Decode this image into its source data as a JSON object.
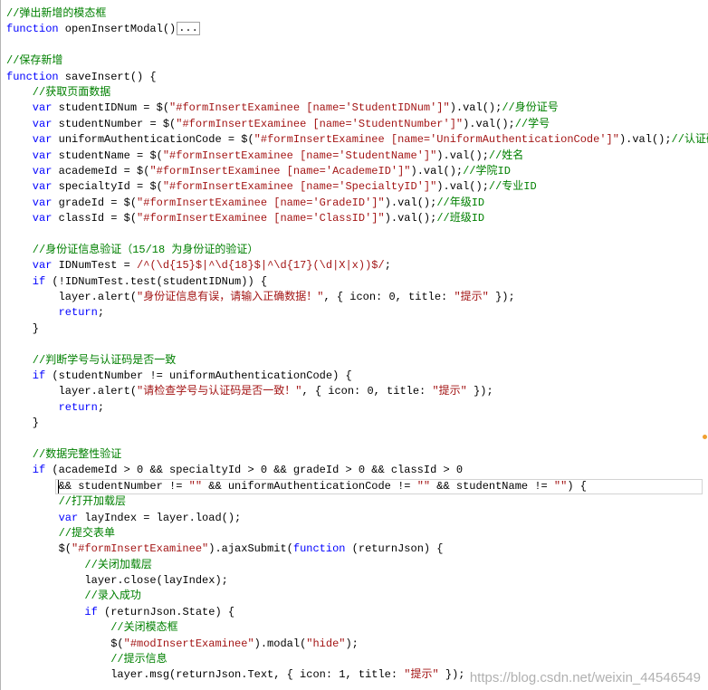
{
  "editor": {
    "colors": {
      "kw": "#0000FF",
      "cm": "#008000",
      "str": "#A31515",
      "re": "#A31515",
      "tx": "#000000",
      "fold": "#000000"
    },
    "lines": [
      {
        "tokens": [
          {
            "cm": "//弹出新增的模态框"
          }
        ]
      },
      {
        "tokens": [
          {
            "kw": "function"
          },
          {
            "tx": " openInsertModal()"
          },
          {
            "fold": "..."
          }
        ]
      },
      {
        "tokens": []
      },
      {
        "tokens": [
          {
            "cm": "//保存新增"
          }
        ]
      },
      {
        "tokens": [
          {
            "kw": "function"
          },
          {
            "tx": " saveInsert() {"
          }
        ]
      },
      {
        "tokens": [
          {
            "cm": "    //获取页面数据"
          }
        ]
      },
      {
        "tokens": [
          {
            "kw": "    var"
          },
          {
            "tx": " studentIDNum = $("
          },
          {
            "str": "\"#formInsertExaminee [name='StudentIDNum']\""
          },
          {
            "tx": ").val();"
          },
          {
            "cm": "//身份证号"
          }
        ]
      },
      {
        "tokens": [
          {
            "kw": "    var"
          },
          {
            "tx": " studentNumber = $("
          },
          {
            "str": "\"#formInsertExaminee [name='StudentNumber']\""
          },
          {
            "tx": ").val();"
          },
          {
            "cm": "//学号"
          }
        ]
      },
      {
        "tokens": [
          {
            "kw": "    var"
          },
          {
            "tx": " uniformAuthenticationCode = $("
          },
          {
            "str": "\"#formInsertExaminee [name='UniformAuthenticationCode']\""
          },
          {
            "tx": ").val();"
          },
          {
            "cm": "//认证码"
          }
        ]
      },
      {
        "tokens": [
          {
            "kw": "    var"
          },
          {
            "tx": " studentName = $("
          },
          {
            "str": "\"#formInsertExaminee [name='StudentName']\""
          },
          {
            "tx": ").val();"
          },
          {
            "cm": "//姓名"
          }
        ]
      },
      {
        "tokens": [
          {
            "kw": "    var"
          },
          {
            "tx": " academeId = $("
          },
          {
            "str": "\"#formInsertExaminee [name='AcademeID']\""
          },
          {
            "tx": ").val();"
          },
          {
            "cm": "//学院ID"
          }
        ]
      },
      {
        "tokens": [
          {
            "kw": "    var"
          },
          {
            "tx": " specialtyId = $("
          },
          {
            "str": "\"#formInsertExaminee [name='SpecialtyID']\""
          },
          {
            "tx": ").val();"
          },
          {
            "cm": "//专业ID"
          }
        ]
      },
      {
        "tokens": [
          {
            "kw": "    var"
          },
          {
            "tx": " gradeId = $("
          },
          {
            "str": "\"#formInsertExaminee [name='GradeID']\""
          },
          {
            "tx": ").val();"
          },
          {
            "cm": "//年级ID"
          }
        ]
      },
      {
        "tokens": [
          {
            "kw": "    var"
          },
          {
            "tx": " classId = $("
          },
          {
            "str": "\"#formInsertExaminee [name='ClassID']\""
          },
          {
            "tx": ").val();"
          },
          {
            "cm": "//班级ID"
          }
        ]
      },
      {
        "tokens": []
      },
      {
        "tokens": [
          {
            "cm": "    //身份证信息验证（15/18 为身份证的验证）"
          }
        ]
      },
      {
        "tokens": [
          {
            "kw": "    var"
          },
          {
            "tx": " IDNumTest = "
          },
          {
            "re": "/^(\\d{15}$|^\\d{18}$|^\\d{17}(\\d|X|x))$/"
          },
          {
            "tx": ";"
          }
        ]
      },
      {
        "tokens": [
          {
            "kw": "    if"
          },
          {
            "tx": " (!IDNumTest.test(studentIDNum)) {"
          }
        ]
      },
      {
        "tokens": [
          {
            "tx": "        layer.alert("
          },
          {
            "str": "\"身份证信息有误，请输入正确数据！\""
          },
          {
            "tx": ", { icon: 0, title: "
          },
          {
            "str": "\"提示\""
          },
          {
            "tx": " });"
          }
        ]
      },
      {
        "tokens": [
          {
            "kw": "        return"
          },
          {
            "tx": ";"
          }
        ]
      },
      {
        "tokens": [
          {
            "tx": "    }"
          }
        ]
      },
      {
        "tokens": []
      },
      {
        "tokens": [
          {
            "cm": "    //判断学号与认证码是否一致"
          }
        ]
      },
      {
        "tokens": [
          {
            "kw": "    if"
          },
          {
            "tx": " (studentNumber != uniformAuthenticationCode) {"
          }
        ]
      },
      {
        "tokens": [
          {
            "tx": "        layer.alert("
          },
          {
            "str": "\"请检查学号与认证码是否一致！\""
          },
          {
            "tx": ", { icon: 0, title: "
          },
          {
            "str": "\"提示\""
          },
          {
            "tx": " });"
          }
        ]
      },
      {
        "tokens": [
          {
            "kw": "        return"
          },
          {
            "tx": ";"
          }
        ]
      },
      {
        "tokens": [
          {
            "tx": "    }"
          }
        ]
      },
      {
        "tokens": []
      },
      {
        "tokens": [
          {
            "cm": "    //数据完整性验证"
          }
        ]
      },
      {
        "tokens": [
          {
            "kw": "    if"
          },
          {
            "tx": " (academeId > 0 && specialtyId > 0 && gradeId > 0 && classId > 0"
          }
        ]
      },
      {
        "current": true,
        "tokens": [
          {
            "tx": "        && studentNumber != "
          },
          {
            "str": "\"\""
          },
          {
            "tx": " && uniformAuthenticationCode != "
          },
          {
            "str": "\"\""
          },
          {
            "tx": " && studentName != "
          },
          {
            "str": "\"\""
          },
          {
            "tx": ") {"
          }
        ]
      },
      {
        "tokens": [
          {
            "cm": "        //打开加载层"
          }
        ]
      },
      {
        "tokens": [
          {
            "kw": "        var"
          },
          {
            "tx": " layIndex = layer.load();"
          }
        ]
      },
      {
        "tokens": [
          {
            "cm": "        //提交表单"
          }
        ]
      },
      {
        "tokens": [
          {
            "tx": "        $("
          },
          {
            "str": "\"#formInsertExaminee\""
          },
          {
            "tx": ").ajaxSubmit("
          },
          {
            "kw": "function"
          },
          {
            "tx": " (returnJson) {"
          }
        ]
      },
      {
        "tokens": [
          {
            "cm": "            //关闭加载层"
          }
        ]
      },
      {
        "tokens": [
          {
            "tx": "            layer.close(layIndex);"
          }
        ]
      },
      {
        "tokens": [
          {
            "cm": "            //录入成功"
          }
        ]
      },
      {
        "tokens": [
          {
            "kw": "            if"
          },
          {
            "tx": " (returnJson.State) {"
          }
        ]
      },
      {
        "tokens": [
          {
            "cm": "                //关闭模态框"
          }
        ]
      },
      {
        "tokens": [
          {
            "tx": "                $("
          },
          {
            "str": "\"#modInsertExaminee\""
          },
          {
            "tx": ").modal("
          },
          {
            "str": "\"hide\""
          },
          {
            "tx": ");"
          }
        ]
      },
      {
        "tokens": [
          {
            "cm": "                //提示信息"
          }
        ]
      },
      {
        "tokens": [
          {
            "tx": "                layer.msg(returnJson.Text, { icon: 1, title: "
          },
          {
            "str": "\"提示\""
          },
          {
            "tx": " });"
          }
        ]
      }
    ]
  },
  "watermark": "https://blog.csdn.net/weixin_44546549"
}
